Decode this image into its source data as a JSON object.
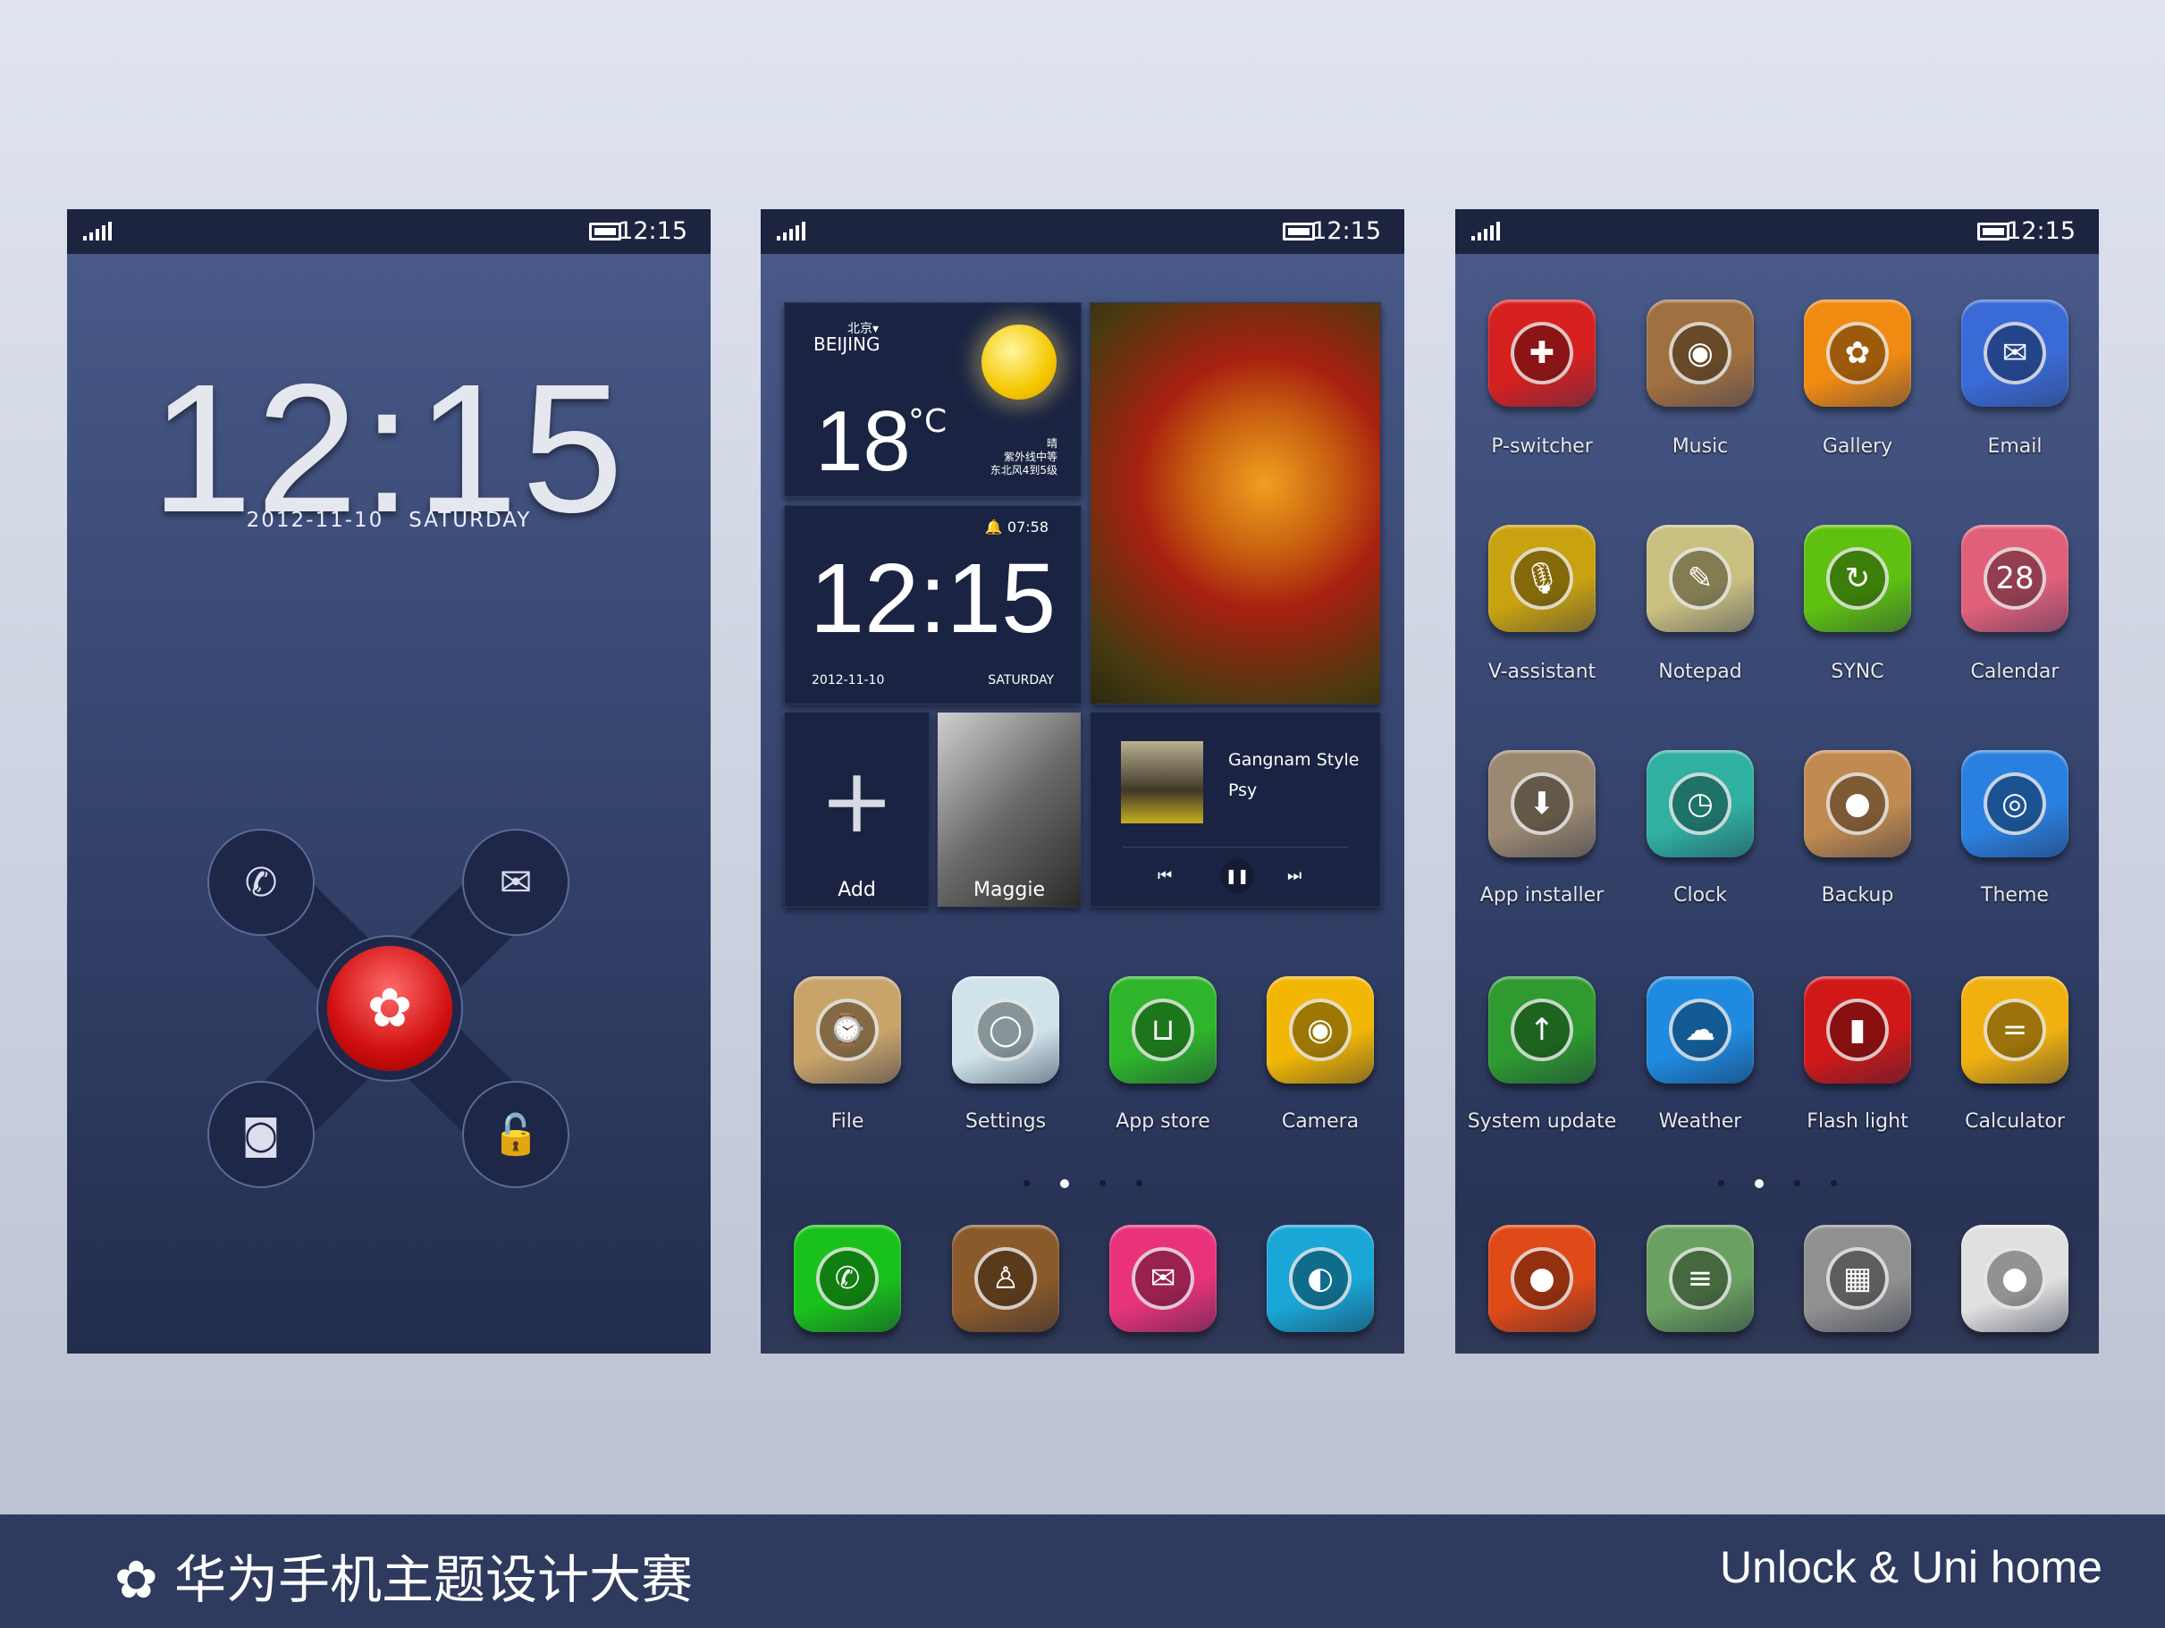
{
  "status": {
    "time": "12:15"
  },
  "lockscreen": {
    "time": "12:15",
    "date": "2012-11-10",
    "day": "SATURDAY"
  },
  "home": {
    "weather": {
      "city_cn": "北京▾",
      "city": "BEIJING",
      "temp": "18",
      "unit": "°C",
      "condition": "晴",
      "uv": "紫外线中等",
      "wind": "东北风4到5级"
    },
    "clock": {
      "alarm": "07:58",
      "time": "12:15",
      "date": "2012-11-10",
      "day": "SATURDAY"
    },
    "add_label": "Add",
    "contact_label": "Maggie",
    "music": {
      "title": "Gangnam Style",
      "artist": "Psy"
    },
    "apps": [
      {
        "label": "File",
        "color": "#c9a46a",
        "glyph": "⌚"
      },
      {
        "label": "Settings",
        "color": "#cfe3ea",
        "glyph": "◯"
      },
      {
        "label": "App store",
        "color": "#2fb52b",
        "glyph": "⊔"
      },
      {
        "label": "Camera",
        "color": "#f2b705",
        "glyph": "◉"
      }
    ],
    "dock": [
      {
        "name": "phone",
        "color": "#19c21a",
        "glyph": "✆"
      },
      {
        "name": "contacts",
        "color": "#8a5a2a",
        "glyph": "♙"
      },
      {
        "name": "messages",
        "color": "#e8337a",
        "glyph": "✉"
      },
      {
        "name": "browser",
        "color": "#1aa6d6",
        "glyph": "◐"
      }
    ],
    "page": 1
  },
  "drawer": {
    "apps": [
      {
        "label": "P-switcher",
        "color": "#d62020",
        "glyph": "✚"
      },
      {
        "label": "Music",
        "color": "#a07040",
        "glyph": "◉"
      },
      {
        "label": "Gallery",
        "color": "#f08a10",
        "glyph": "✿"
      },
      {
        "label": "Email",
        "color": "#3a6ad6",
        "glyph": "✉"
      },
      {
        "label": "V-assistant",
        "color": "#c9a210",
        "glyph": "🎙"
      },
      {
        "label": "Notepad",
        "color": "#c9bf80",
        "glyph": "✎"
      },
      {
        "label": "SYNC",
        "color": "#5ec010",
        "glyph": "↻"
      },
      {
        "label": "Calendar",
        "color": "#e0607a",
        "glyph": "28"
      },
      {
        "label": "App installer",
        "color": "#9a8870",
        "glyph": "⬇"
      },
      {
        "label": "Clock",
        "color": "#30b0a0",
        "glyph": "◷"
      },
      {
        "label": "Backup",
        "color": "#c08a50",
        "glyph": "●"
      },
      {
        "label": "Theme",
        "color": "#2a80e0",
        "glyph": "◎"
      },
      {
        "label": "System update",
        "color": "#2e9a30",
        "glyph": "↑"
      },
      {
        "label": "Weather",
        "color": "#1f8ae0",
        "glyph": "☁"
      },
      {
        "label": "Flash light",
        "color": "#d01818",
        "glyph": "▮"
      },
      {
        "label": "Calculator",
        "color": "#f0b010",
        "glyph": "="
      }
    ],
    "dock": [
      {
        "name": "recorder",
        "color": "#e04a18",
        "glyph": "●"
      },
      {
        "name": "radio",
        "color": "#6aa060",
        "glyph": "≡"
      },
      {
        "name": "tools",
        "color": "#909090",
        "glyph": "▦"
      },
      {
        "name": "more",
        "color": "#e0e0e0",
        "glyph": "●"
      }
    ],
    "page": 1
  },
  "footer": {
    "brand": "华为手机主题设计大赛",
    "tagline": "Unlock & Uni home"
  }
}
